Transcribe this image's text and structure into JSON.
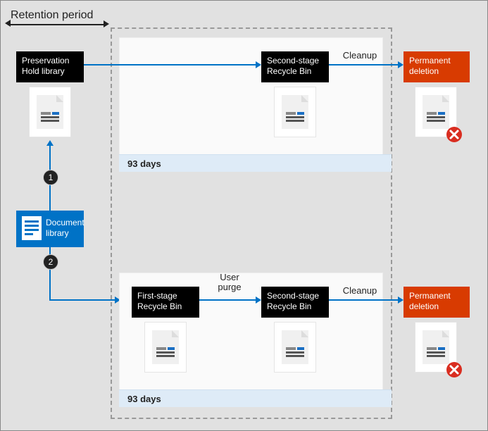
{
  "title": "Retention period",
  "path1": {
    "footer": "93 days",
    "box_preservation": {
      "line1": "Preservation",
      "line2": "Hold library"
    },
    "box_second_stage": {
      "line1": "Second-stage",
      "line2": "Recycle Bin"
    },
    "label_cleanup": "Cleanup",
    "box_permanent": {
      "line1": "Permanent",
      "line2": "deletion"
    }
  },
  "path2": {
    "footer": "93 days",
    "box_first_stage": {
      "line1": "First-stage",
      "line2": "Recycle Bin"
    },
    "label_user_purge": {
      "line1": "User",
      "line2": "purge"
    },
    "box_second_stage": {
      "line1": "Second-stage",
      "line2": "Recycle Bin"
    },
    "label_cleanup": "Cleanup",
    "box_permanent": {
      "line1": "Permanent",
      "line2": "deletion"
    }
  },
  "source": {
    "line1": "Document",
    "line2": "library"
  },
  "badges": {
    "one": "1",
    "two": "2"
  }
}
